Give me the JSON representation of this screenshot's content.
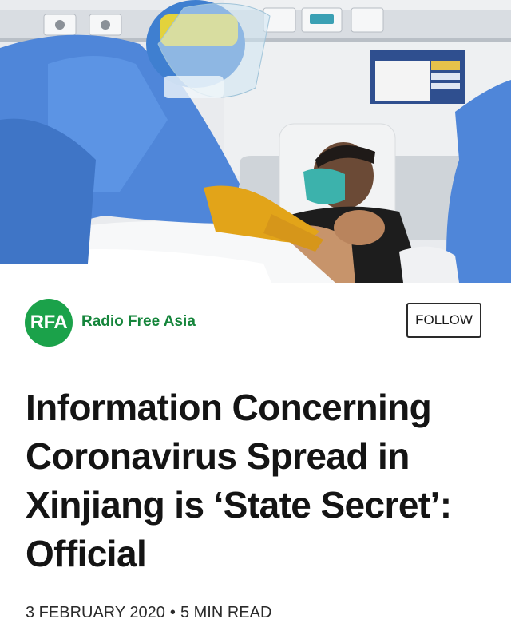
{
  "publisher": {
    "logo_text": "RFA",
    "name": "Radio Free Asia",
    "follow_label": "FOLLOW",
    "brand_color": "#1ba24a"
  },
  "article": {
    "headline": "Information Concerning Coronavirus Spread in Xinjiang is ‘State Secret’: Official",
    "date": "3 FEBRUARY 2020",
    "separator": "•",
    "read_time": "5 MIN READ"
  }
}
